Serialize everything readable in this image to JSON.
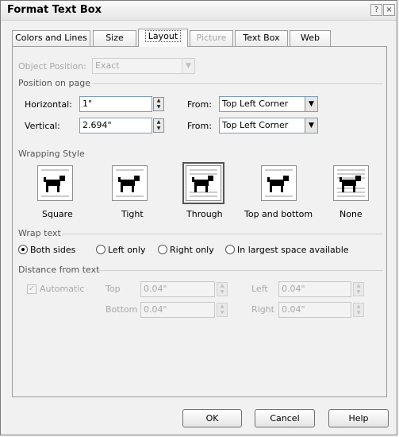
{
  "window": {
    "title": "Format Text Box",
    "help_glyph": "?",
    "close_glyph": "×"
  },
  "tabs": [
    {
      "label": "Colors and Lines"
    },
    {
      "label": "Size"
    },
    {
      "label": "Layout"
    },
    {
      "label": "Picture"
    },
    {
      "label": "Text Box"
    },
    {
      "label": "Web"
    }
  ],
  "object_position": {
    "label": "Object Position:",
    "value": "Exact"
  },
  "position": {
    "group_title": "Position on page",
    "horizontal": {
      "label": "Horizontal:",
      "value": "1\"",
      "from_label": "From:",
      "from_value": "Top Left Corner"
    },
    "vertical": {
      "label": "Vertical:",
      "value": "2.694\"",
      "from_label": "From:",
      "from_value": "Top Left Corner"
    }
  },
  "wrapping": {
    "group_title": "Wrapping Style",
    "styles": [
      {
        "label": "Square",
        "icon": "wrap-square-icon"
      },
      {
        "label": "Tight",
        "icon": "wrap-tight-icon"
      },
      {
        "label": "Through",
        "icon": "wrap-through-icon"
      },
      {
        "label": "Top and bottom",
        "icon": "wrap-top-bottom-icon"
      },
      {
        "label": "None",
        "icon": "wrap-none-icon"
      }
    ],
    "selected": "Through"
  },
  "wrap_text": {
    "group_title": "Wrap text",
    "options": [
      {
        "label": "Both sides"
      },
      {
        "label": "Left only"
      },
      {
        "label": "Right only"
      },
      {
        "label": "In largest space available"
      }
    ],
    "selected": "Both sides"
  },
  "distance": {
    "group_title": "Distance from text",
    "automatic_label": "Automatic",
    "top": {
      "label": "Top",
      "value": "0.04\""
    },
    "bottom": {
      "label": "Bottom",
      "value": "0.04\""
    },
    "left": {
      "label": "Left",
      "value": "0.04\""
    },
    "right": {
      "label": "Right",
      "value": "0.04\""
    }
  },
  "buttons": {
    "ok": "OK",
    "cancel": "Cancel",
    "help": "Help"
  }
}
